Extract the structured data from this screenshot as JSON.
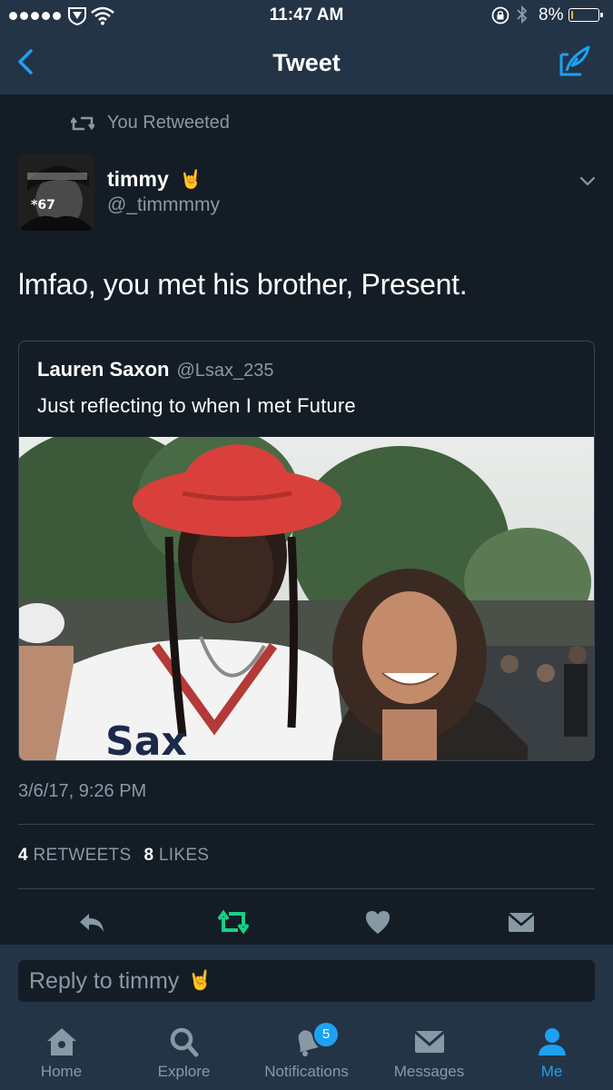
{
  "status_bar": {
    "time": "11:47 AM",
    "battery": "8%",
    "battery_level": 0.08
  },
  "nav": {
    "title": "Tweet"
  },
  "retweet_notice": "You Retweeted",
  "tweet": {
    "display_name": "timmy",
    "name_emoji": "🤘",
    "handle": "@_timmmmy",
    "avatar_caption": "*67",
    "text": "lmfao, you met his brother, Present.",
    "timestamp": "3/6/17, 9:26 PM",
    "retweets": "4",
    "retweets_label": "RETWEETS",
    "likes": "8",
    "likes_label": "LIKES"
  },
  "quoted_tweet": {
    "display_name": "Lauren Saxon",
    "handle": "@Lsax_235",
    "text": "Just reflecting to when I met Future"
  },
  "reply": {
    "placeholder": "Reply to timmy",
    "emoji": "🤘"
  },
  "tabs": [
    {
      "label": "Home",
      "icon": "home-icon"
    },
    {
      "label": "Explore",
      "icon": "search-icon"
    },
    {
      "label": "Notifications",
      "icon": "bell-icon",
      "badge": "5"
    },
    {
      "label": "Messages",
      "icon": "envelope-icon"
    },
    {
      "label": "Me",
      "icon": "person-icon",
      "active": true
    }
  ],
  "colors": {
    "accent": "#1da1f2",
    "retweet_green": "#19cf86",
    "background": "#141d26",
    "bar": "#243447",
    "secondary_text": "#8899a6"
  }
}
